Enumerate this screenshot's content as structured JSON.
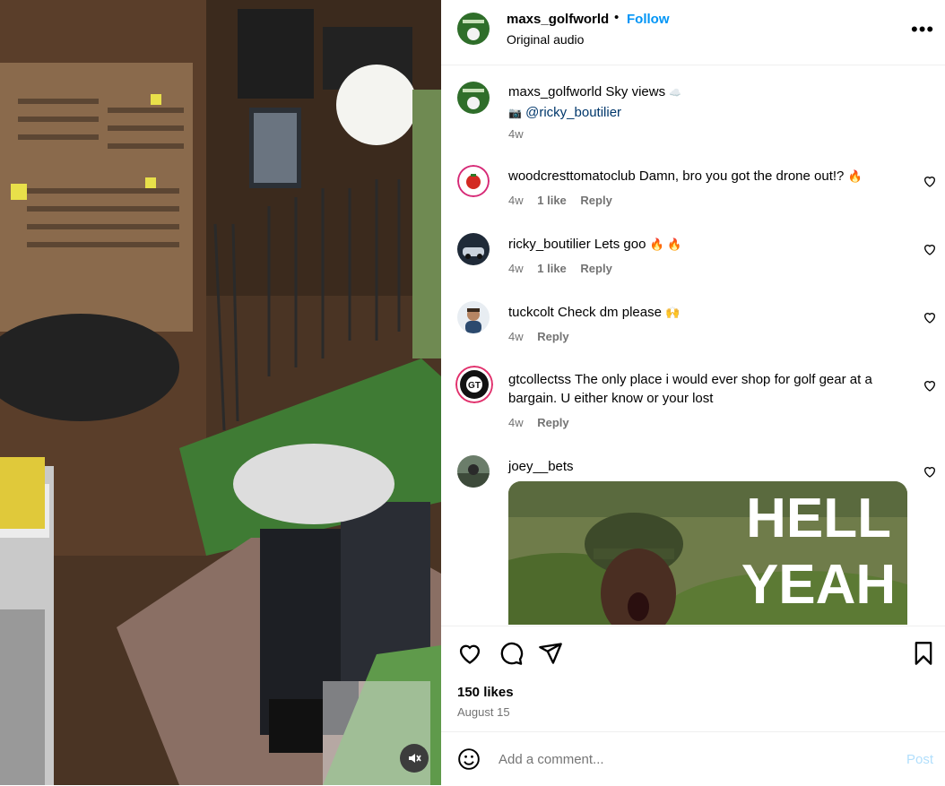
{
  "post": {
    "username": "maxs_golfworld",
    "separator": "•",
    "follow_label": "Follow",
    "audio_label": "Original audio",
    "more_icon": "more-horizontal-icon",
    "caption": {
      "username": "maxs_golfworld",
      "text": "Sky views",
      "cloud_emoji": "☁️",
      "camera_emoji": "📷",
      "mention": "@ricky_boutilier",
      "time": "4w"
    }
  },
  "comments": [
    {
      "username": "woodcresttomatoclub",
      "text": "Damn, bro you got the drone out!?",
      "emoji": "🔥",
      "time": "4w",
      "likes": "1 like",
      "reply": "Reply"
    },
    {
      "username": "ricky_boutilier",
      "text": "Lets goo",
      "emoji": "🔥 🔥",
      "time": "4w",
      "likes": "1 like",
      "reply": "Reply"
    },
    {
      "username": "tuckcolt",
      "text": "Check dm please",
      "emoji": "🙌",
      "time": "4w",
      "reply": "Reply"
    },
    {
      "username": "gtcollectss",
      "text": "The only place i would ever shop for golf gear at a bargain. U either know or your lost",
      "time": "4w",
      "reply": "Reply"
    },
    {
      "username": "joey__bets",
      "gif_text_line1": "HELL",
      "gif_text_line2": "YEAH"
    }
  ],
  "actions": {
    "like_icon": "heart-icon",
    "comment_icon": "comment-icon",
    "share_icon": "share-icon",
    "save_icon": "bookmark-icon",
    "likes_count": "150 likes",
    "date": "August 15"
  },
  "composer": {
    "emoji_icon": "emoji-icon",
    "placeholder": "Add a comment...",
    "post_label": "Post"
  },
  "media": {
    "mute_icon": "speaker-muted-icon"
  }
}
